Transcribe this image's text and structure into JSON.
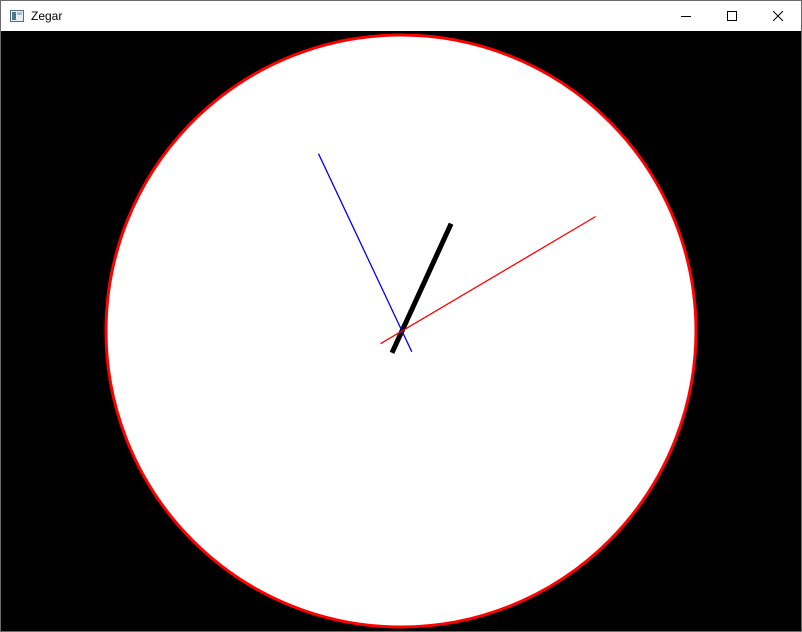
{
  "window": {
    "title": "Zegar",
    "icon": "app-window-icon",
    "controls": {
      "minimize_icon": "minimize-icon",
      "maximize_icon": "maximize-icon",
      "close_icon": "close-icon"
    }
  },
  "clock": {
    "background_color": "#000000",
    "face_color": "#ffffff",
    "rim_color": "#ff0000",
    "hands": {
      "hour": {
        "color": "#000000",
        "position_hours": 0.82
      },
      "minute": {
        "color": "#0000ff",
        "position_minutes": 55.8
      },
      "second": {
        "color": "#ff0000",
        "position_seconds": 9.9
      }
    }
  }
}
